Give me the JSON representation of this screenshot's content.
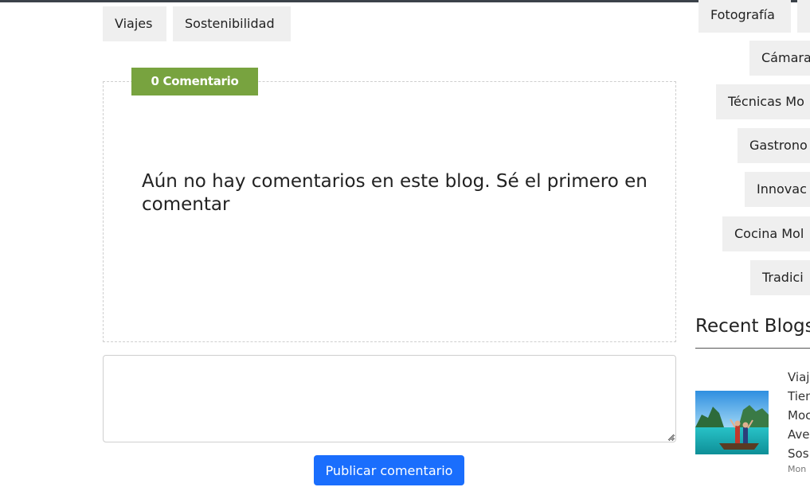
{
  "tags_main": [
    "Viajes",
    "Sostenibilidad"
  ],
  "tags_sidebar": [
    "Fotografía",
    "Cámara",
    "Técnicas Mo",
    "Gastrono",
    "Innovac",
    "Cocina Mol",
    "Tradici"
  ],
  "comments": {
    "count_label": "0 Comentario",
    "empty_message": "Aún no hay comentarios en este blog. Sé el primero en comentar",
    "input_value": "",
    "publish_label": "Publicar comentario"
  },
  "recent": {
    "heading": "Recent Blogs",
    "post": {
      "title_lines": [
        "Viaj",
        "Tien",
        "Moc",
        "Ave",
        "Sos"
      ],
      "date": "Mon"
    }
  },
  "colors": {
    "badge": "#78a33f",
    "button": "#1a6efd",
    "tag_bg": "#efefef"
  }
}
